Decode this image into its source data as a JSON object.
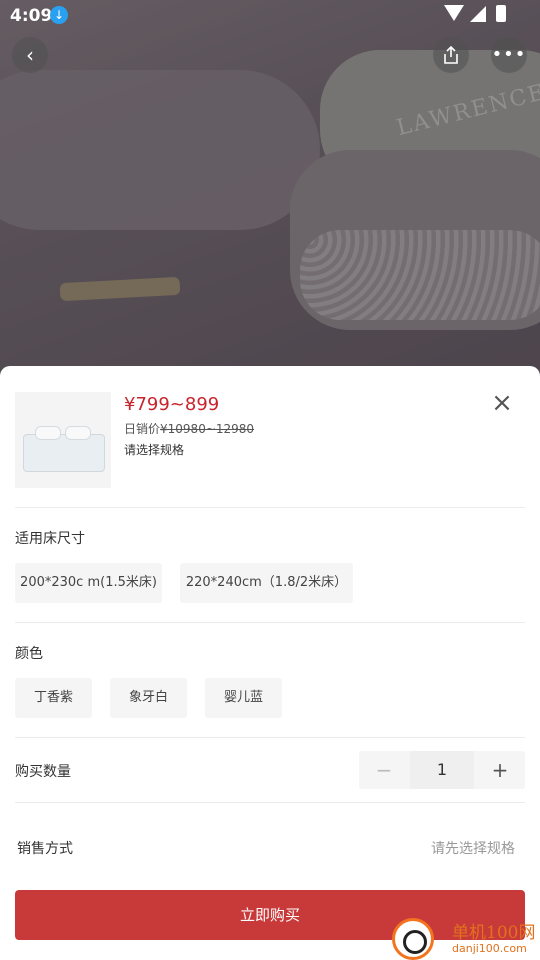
{
  "status_bar": {
    "time": "4:09"
  },
  "hero": {
    "embroidery_text": "LAWRENCE"
  },
  "product": {
    "price": "¥799~899",
    "daily_label": "日销价",
    "daily_price": "¥10980~12980",
    "select_prompt": "请选择规格"
  },
  "size_section": {
    "title": "适用床尺寸",
    "options": [
      "200*230c m(1.5米床)",
      "220*240cm（1.8/2米床）"
    ]
  },
  "color_section": {
    "title": "颜色",
    "options": [
      "丁香紫",
      "象牙白",
      "婴儿蓝"
    ]
  },
  "quantity_section": {
    "title": "购买数量",
    "minus": "−",
    "value": "1",
    "plus": "+"
  },
  "sale_section": {
    "title": "销售方式",
    "hint": "请先选择规格"
  },
  "buy_button": "立即购买",
  "watermark": {
    "line1": "单机100网",
    "line2": "danji100.com"
  },
  "colors": {
    "price_red": "#c8242b",
    "buy_button": "#c83a3a"
  }
}
